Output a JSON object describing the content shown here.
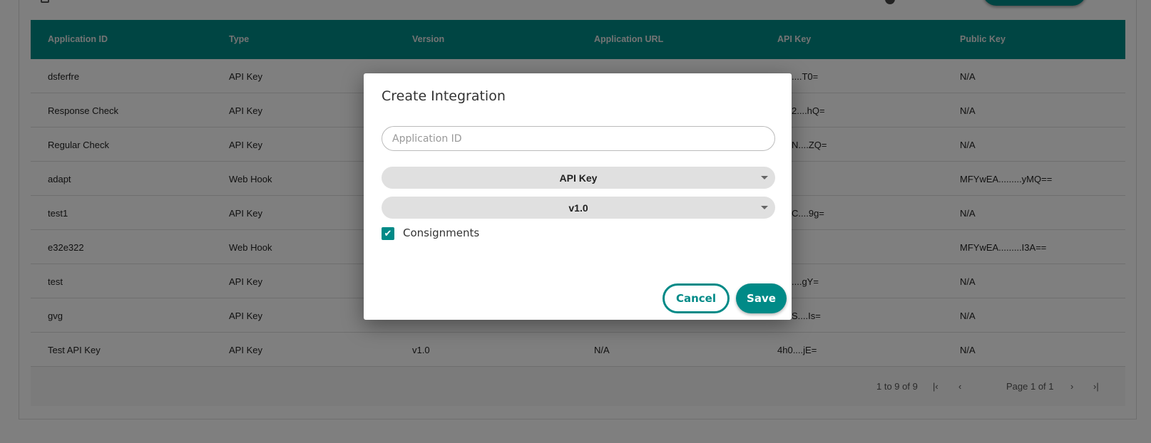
{
  "table": {
    "columns": [
      "Application ID",
      "Type",
      "Version",
      "Application URL",
      "API Key",
      "Public Key"
    ],
    "rows": [
      [
        "dsferfre",
        "API Key",
        "",
        "",
        "....T0=",
        "N/A"
      ],
      [
        "Response Check",
        "API Key",
        "",
        "",
        "2....hQ=",
        "N/A"
      ],
      [
        "Regular Check",
        "API Key",
        "",
        "",
        "N....ZQ=",
        "N/A"
      ],
      [
        "adapt",
        "Web Hook",
        "",
        "",
        "",
        "MFYwEA.........yMQ=="
      ],
      [
        "test1",
        "API Key",
        "",
        "",
        "C....9g=",
        "N/A"
      ],
      [
        "e32e322",
        "Web Hook",
        "",
        "",
        "",
        "MFYwEA.........I3A=="
      ],
      [
        "test",
        "API Key",
        "",
        "",
        "....gY=",
        "N/A"
      ],
      [
        "gvg",
        "API Key",
        "",
        "",
        "S....Is=",
        "N/A"
      ],
      [
        "Test API Key",
        "API Key",
        "v1.0",
        "N/A",
        "4h0....jE=",
        "N/A"
      ]
    ]
  },
  "pagination": {
    "summary": "1 to 9 of 9",
    "page_label": "Page 1 of 1"
  },
  "modal": {
    "title": "Create Integration",
    "app_id_placeholder": "Application ID",
    "app_id_value": "",
    "type_select": "API Key",
    "version_select": "v1.0",
    "consignments_label": "Consignments",
    "consignments_checked": true,
    "cancel_label": "Cancel",
    "save_label": "Save"
  },
  "colors": {
    "accent": "#008a87"
  }
}
